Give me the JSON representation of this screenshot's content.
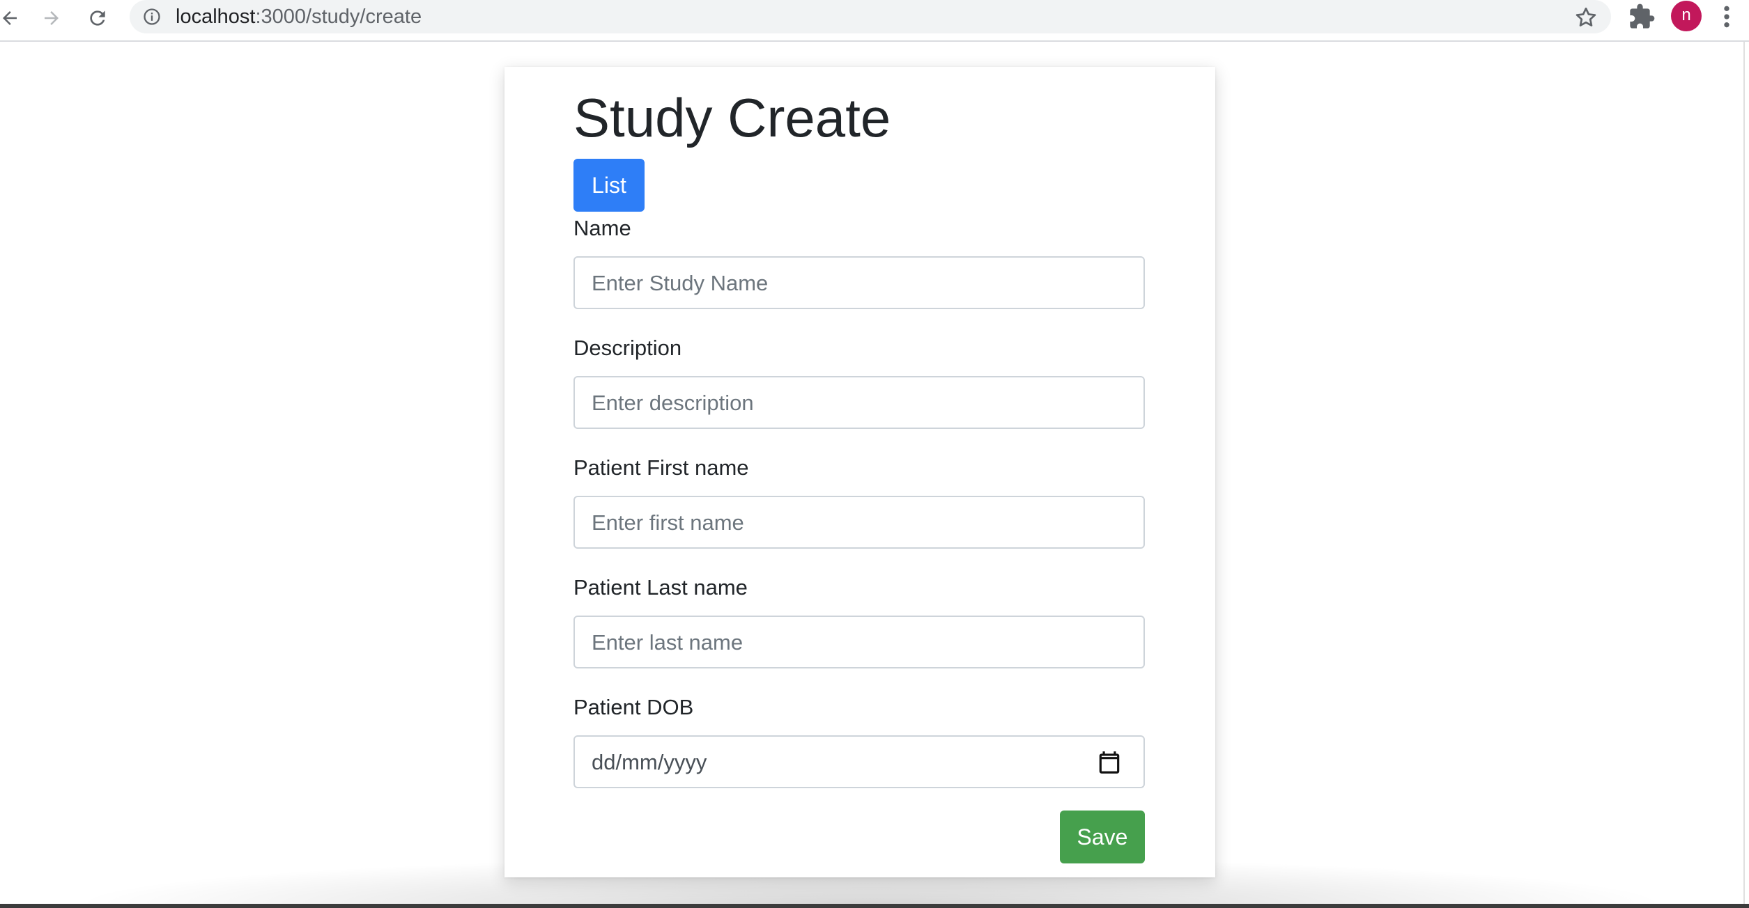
{
  "browser": {
    "url_host": "localhost",
    "url_path": ":3000/study/create",
    "profile_initial": "n",
    "icons": {
      "back": "back-arrow-icon",
      "forward": "forward-arrow-icon",
      "reload": "reload-icon",
      "site_info": "info-icon",
      "bookmark": "star-icon",
      "extensions": "puzzle-icon",
      "menu": "kebab-menu-icon"
    }
  },
  "page": {
    "title": "Study Create",
    "list_button_label": "List",
    "save_button_label": "Save",
    "colors": {
      "primary": "#2e7ef7",
      "success": "#46a04d",
      "avatar": "#c2185b"
    }
  },
  "form": {
    "fields": [
      {
        "label": "Name",
        "placeholder": "Enter Study Name"
      },
      {
        "label": "Description",
        "placeholder": "Enter description"
      },
      {
        "label": "Patient First name",
        "placeholder": "Enter first name"
      },
      {
        "label": "Patient Last name",
        "placeholder": "Enter last name"
      },
      {
        "label": "Patient DOB",
        "placeholder": "dd/mm/yyyy",
        "icon": "calendar-icon"
      }
    ]
  }
}
